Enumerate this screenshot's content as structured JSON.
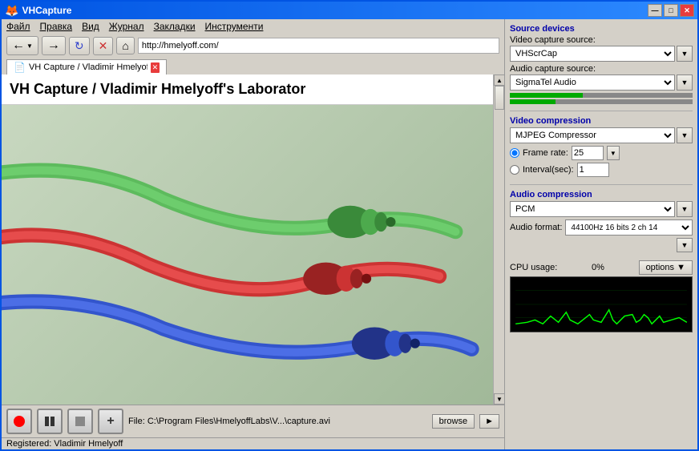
{
  "window": {
    "title": "VHCapture",
    "min_button": "—",
    "max_button": "□",
    "close_button": "✕"
  },
  "browser": {
    "menu_items": [
      "Файл",
      "Правка",
      "Вид",
      "Журнал",
      "Закладки",
      "Инструменти"
    ],
    "back_icon": "←",
    "forward_icon": "→",
    "refresh_icon": "↻",
    "stop_icon": "✕",
    "home_icon": "⌂",
    "address": "http://hmelyoff.com/",
    "tab_title": "VH Capture / Vladimir Hmelyoff's ...",
    "page_heading": "VH Capture / Vladimir Hmelyoff's Laborator"
  },
  "bottom_bar": {
    "file_label": "File:",
    "file_path": "C:\\Program Files\\HmelyoffLabs\\V...\\capture.avi",
    "browse_label": "browse",
    "play_label": "►"
  },
  "status_bar": {
    "text": "Registered: Vladimir Hmelyoff"
  },
  "right_panel": {
    "source_devices_label": "Source devices",
    "video_source_label": "Video capture source:",
    "video_source_value": "VHScrCap",
    "audio_source_label": "Audio capture source:",
    "audio_source_value": "SigmaTel Audio",
    "audio_level1": 40,
    "audio_level2": 25,
    "video_compression_label": "Video compression",
    "video_compression_value": "MJPEG Compressor",
    "frame_rate_label": "Frame rate:",
    "frame_rate_value": "25",
    "interval_label": "Interval(sec):",
    "interval_value": "1",
    "audio_compression_label": "Audio compression",
    "audio_compression_value": "PCM",
    "audio_format_label": "Audio format:",
    "audio_format_value": "44100Hz 16 bits 2 ch 14",
    "cpu_label": "CPU usage:",
    "cpu_value": "0%",
    "options_label": "options ▼"
  }
}
